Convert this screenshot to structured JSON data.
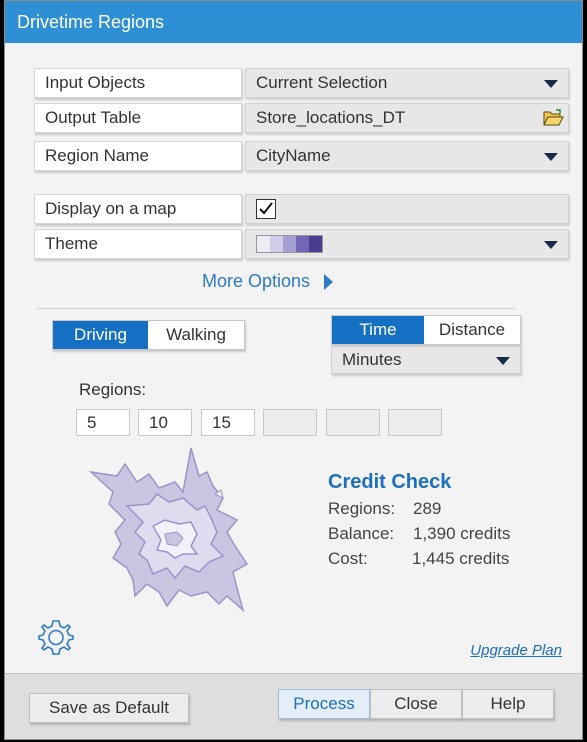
{
  "window": {
    "title": "Drivetime Regions"
  },
  "form": {
    "input_objects": {
      "label": "Input Objects",
      "value": "Current Selection"
    },
    "output_table": {
      "label": "Output Table",
      "value": "Store_locations_DT"
    },
    "region_name": {
      "label": "Region Name",
      "value": "CityName"
    },
    "display_on_map": {
      "label": "Display on a map",
      "checked": true
    },
    "theme": {
      "label": "Theme",
      "swatch_colors": [
        "#ededf6",
        "#cfcde8",
        "#a49fd3",
        "#7266b5",
        "#4a3c93"
      ]
    }
  },
  "more_options": {
    "label": "More Options"
  },
  "mode": {
    "options": [
      "Driving",
      "Walking"
    ],
    "selected": "Driving"
  },
  "measure": {
    "options": [
      "Time",
      "Distance"
    ],
    "selected": "Time",
    "unit": "Minutes"
  },
  "regions": {
    "label": "Regions:",
    "values": [
      "5",
      "10",
      "15",
      "",
      "",
      ""
    ]
  },
  "credit_check": {
    "title": "Credit Check",
    "regions_label": "Regions:",
    "regions_value": "289",
    "balance_label": "Balance:",
    "balance_value": "1,390 credits",
    "cost_label": "Cost:",
    "cost_value": "1,445 credits"
  },
  "upgrade": {
    "label": "Upgrade Plan"
  },
  "footer": {
    "save_default": "Save as Default",
    "process": "Process",
    "close": "Close",
    "help": "Help"
  },
  "colors": {
    "accent": "#1570c4",
    "title_bar": "#2f8fd4",
    "link": "#1e6fbf"
  }
}
